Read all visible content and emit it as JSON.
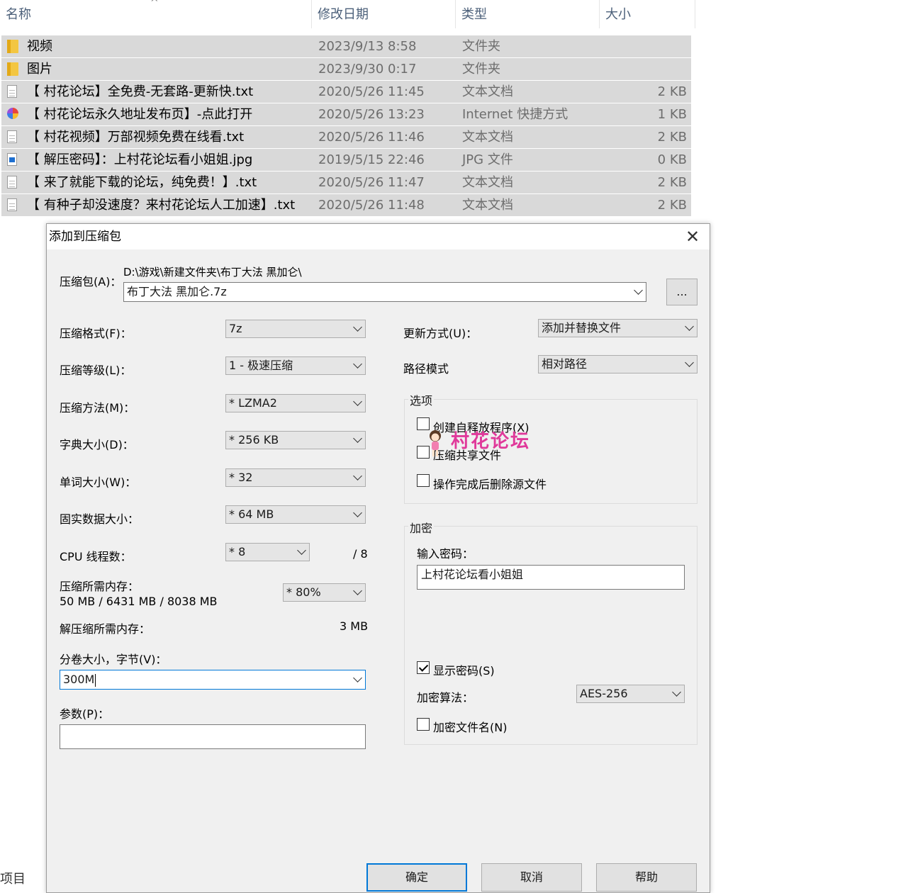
{
  "explorer": {
    "columns": {
      "name": "名称",
      "date": "修改日期",
      "type": "类型",
      "size": "大小"
    },
    "sort_indicator": "^",
    "rows": [
      {
        "icon": "folder-icon",
        "name": "视频",
        "date": "2023/9/13 8:58",
        "type": "文件夹",
        "size": ""
      },
      {
        "icon": "folder-icon",
        "name": "图片",
        "date": "2023/9/30 0:17",
        "type": "文件夹",
        "size": ""
      },
      {
        "icon": "text-file-icon",
        "name": "【 村花论坛】全免费-无套路-更新快.txt",
        "date": "2020/5/26 11:45",
        "type": "文本文档",
        "size": "2 KB"
      },
      {
        "icon": "internet-shortcut-icon",
        "name": "【 村花论坛永久地址发布页】-点此打开",
        "date": "2020/5/26 13:23",
        "type": "Internet 快捷方式",
        "size": "1 KB"
      },
      {
        "icon": "text-file-icon",
        "name": "【 村花视频】万部视频免费在线看.txt",
        "date": "2020/5/26 11:46",
        "type": "文本文档",
        "size": "2 KB"
      },
      {
        "icon": "image-file-icon",
        "name": "【 解压密码】：上村花论坛看小姐姐.jpg",
        "date": "2019/5/15 22:46",
        "type": "JPG 文件",
        "size": "0 KB"
      },
      {
        "icon": "text-file-icon",
        "name": "【 来了就能下载的论坛，纯免费！】.txt",
        "date": "2020/5/26 11:47",
        "type": "文本文档",
        "size": "2 KB"
      },
      {
        "icon": "text-file-icon",
        "name": "【 有种子却没速度？来村花论坛人工加速】.txt",
        "date": "2020/5/26 11:48",
        "type": "文本文档",
        "size": "2 KB"
      }
    ],
    "status_text": "项目"
  },
  "dialog": {
    "title": "添加到压缩包",
    "archive_label": "压缩包(A)：",
    "archive_path": "D:\\游戏\\新建文件夹\\布丁大法  黑加仑\\",
    "archive_name": "布丁大法  黑加仑.7z",
    "browse_label": "...",
    "format_label": "压缩格式(F)：",
    "format_value": "7z",
    "level_label": "压缩等级(L)：",
    "level_value": "1 - 极速压缩",
    "method_label": "压缩方法(M)：",
    "method_value": "* LZMA2",
    "dict_label": "字典大小(D)：",
    "dict_value": "* 256 KB",
    "word_label": "单词大小(W)：",
    "word_value": "* 32",
    "solid_label": "固实数据大小：",
    "solid_value": "* 64 MB",
    "threads_label": "CPU 线程数：",
    "threads_value": "* 8",
    "threads_total": "/ 8",
    "mem_label": "压缩所需内存：",
    "mem_value": "50 MB / 6431 MB / 8038 MB",
    "mem_percent": "* 80%",
    "decomp_label": "解压缩所需内存：",
    "decomp_value": "3 MB",
    "volume_label": "分卷大小，字节(V)：",
    "volume_value": "300M",
    "params_label": "参数(P)：",
    "params_value": "",
    "update_label": "更新方式(U)：",
    "update_value": "添加并替换文件",
    "pathmode_label": "路径模式",
    "pathmode_value": "相对路径",
    "options_title": "选项",
    "opt_sfx": "创建自释放程序(X)",
    "opt_shared": "压缩共享文件",
    "opt_delete": "操作完成后删除源文件",
    "encrypt_title": "加密",
    "password_label": "输入密码：",
    "password_value": "上村花论坛看小姐姐",
    "show_password": "显示密码(S)",
    "algo_label": "加密算法：",
    "algo_value": "AES-256",
    "encrypt_names": "加密文件名(N)",
    "ok": "确定",
    "cancel": "取消",
    "help": "帮助",
    "checkbox_state": {
      "sfx": false,
      "shared": false,
      "delete": false,
      "show_password": true,
      "encrypt_names": false
    }
  },
  "watermark": {
    "text": "村花论坛"
  }
}
